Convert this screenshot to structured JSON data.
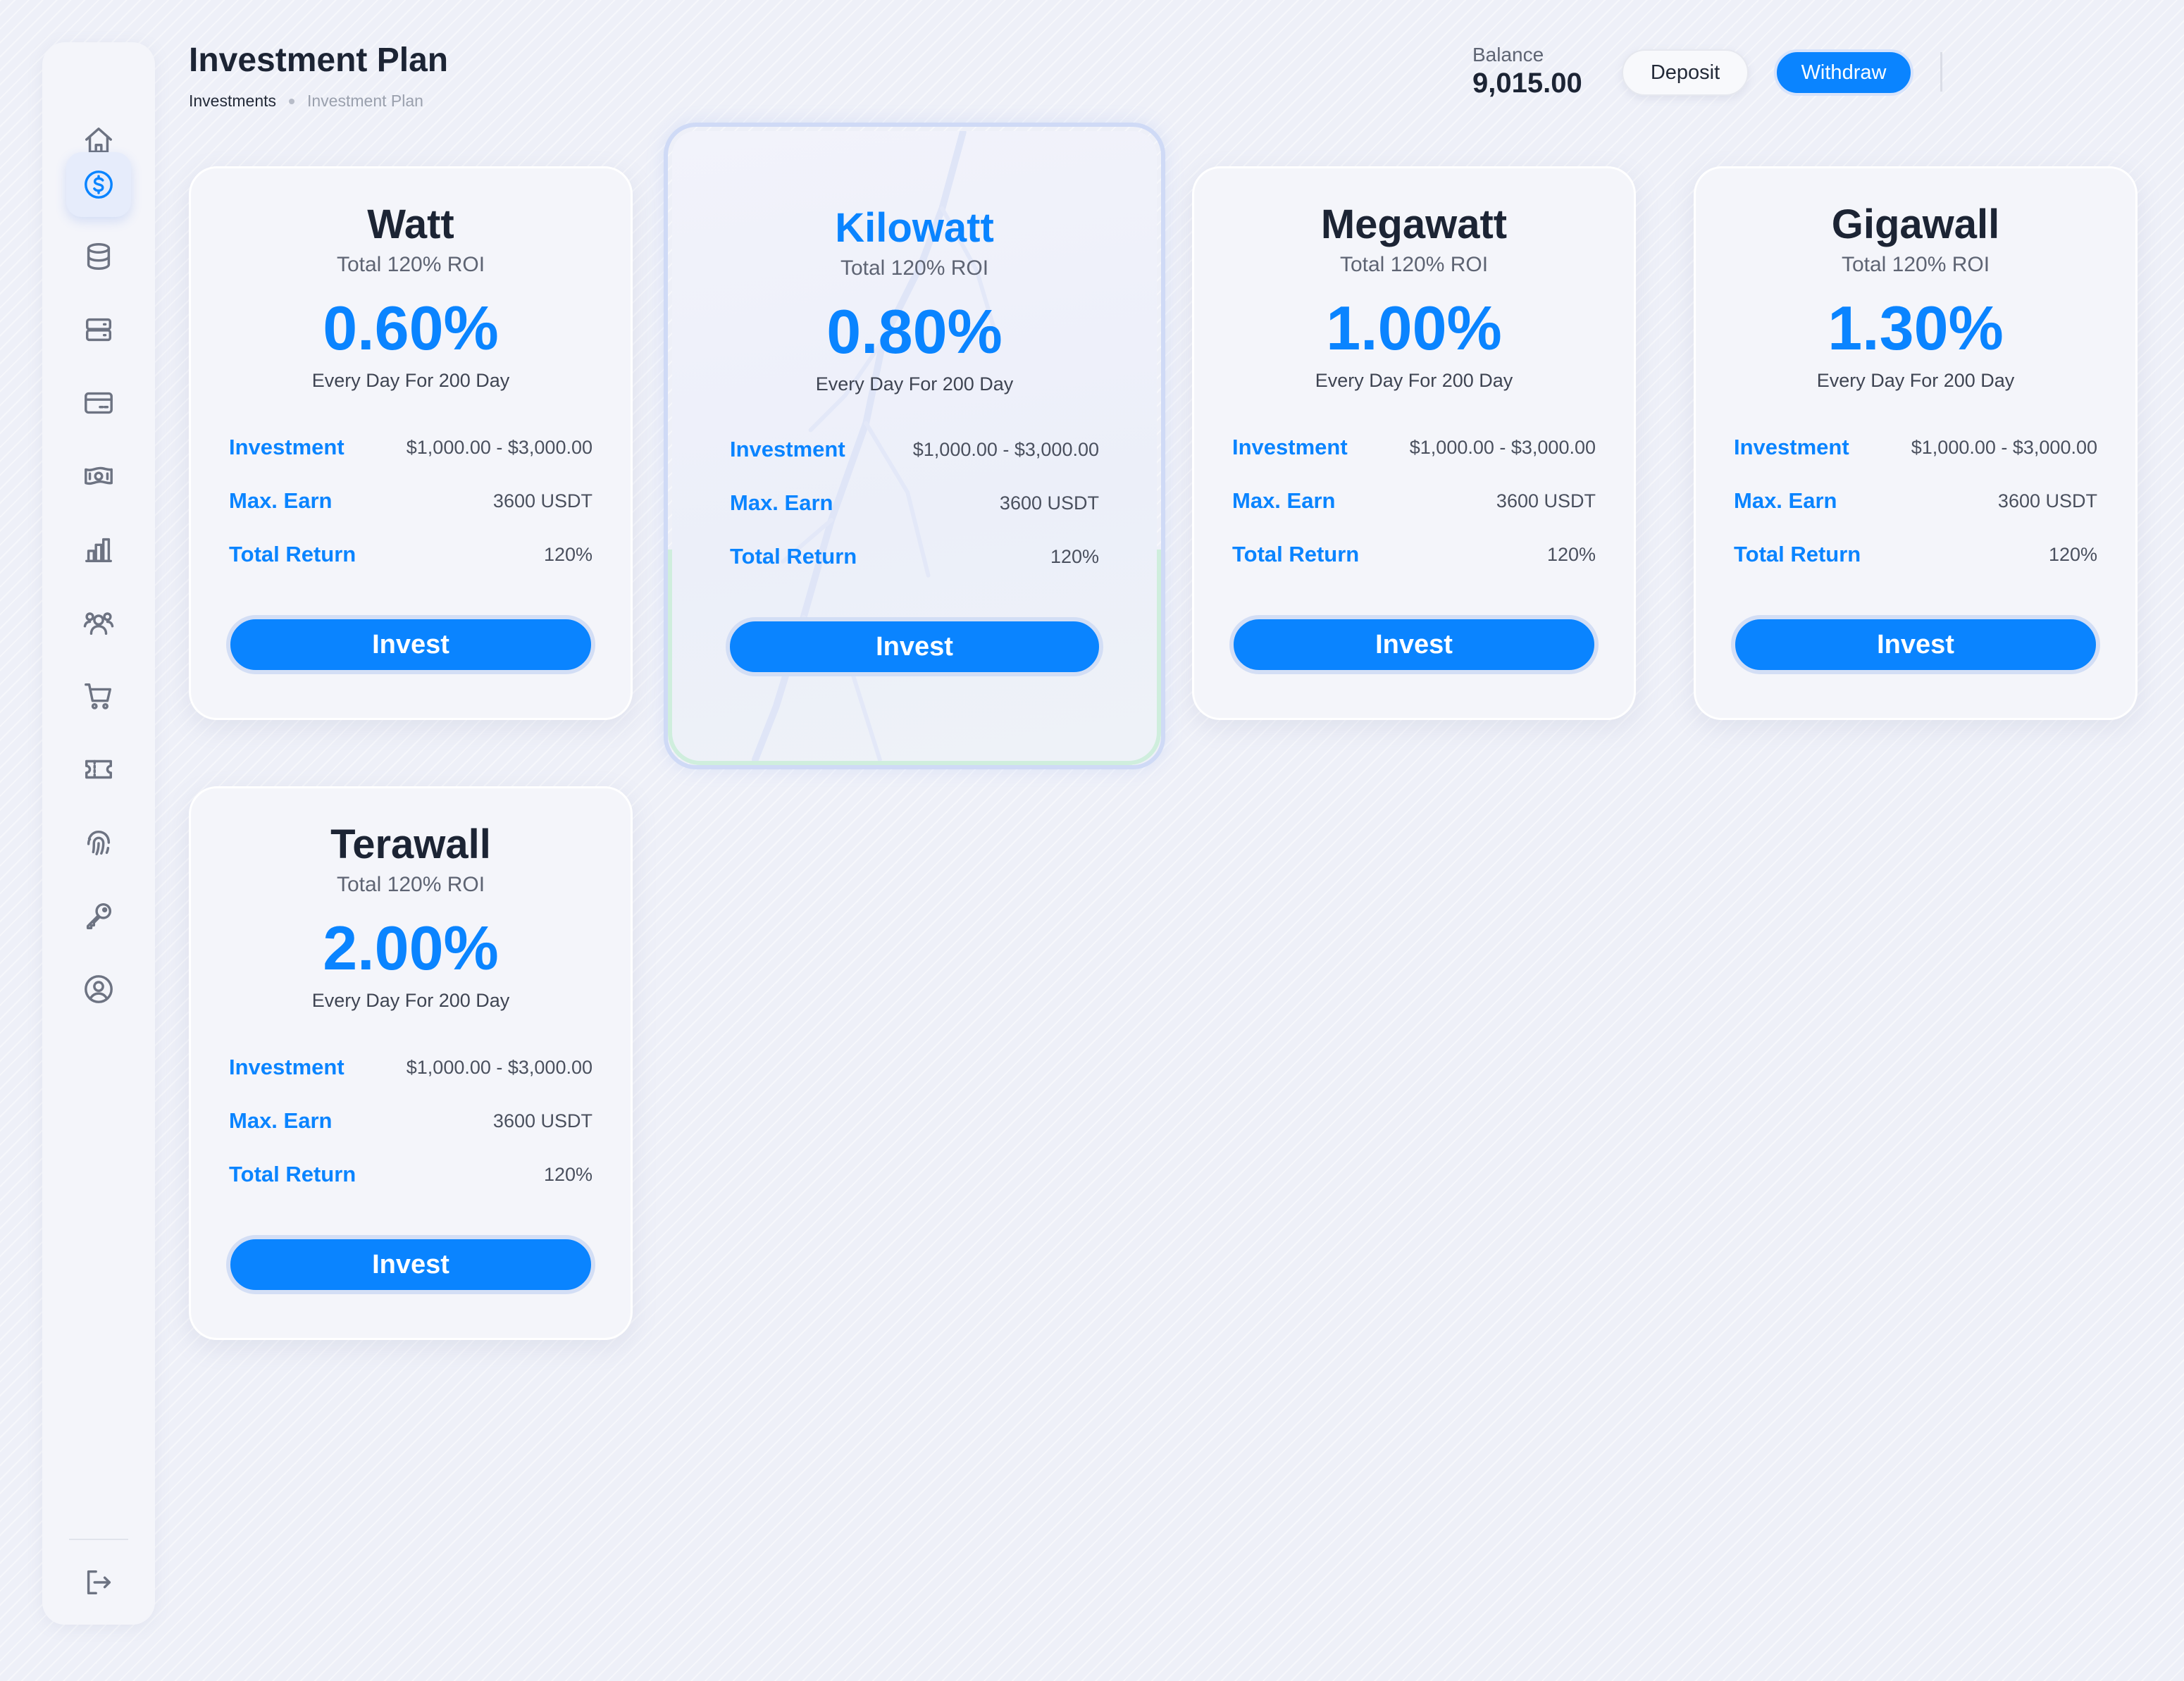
{
  "header": {
    "title": "Investment Plan",
    "breadcrumb": [
      "Investments",
      "Investment Plan"
    ],
    "balance_label": "Balance",
    "balance_value": "9,015.00",
    "deposit_label": "Deposit",
    "withdraw_label": "Withdraw"
  },
  "sidebar": {
    "items": [
      {
        "icon": "home-icon",
        "active": false
      },
      {
        "icon": "dollar-circle-icon",
        "active": true
      },
      {
        "icon": "database-icon",
        "active": false
      },
      {
        "icon": "server-icon",
        "active": false
      },
      {
        "icon": "credit-card-icon",
        "active": false
      },
      {
        "icon": "banknote-icon",
        "active": false
      },
      {
        "icon": "bar-chart-icon",
        "active": false
      },
      {
        "icon": "users-icon",
        "active": false
      },
      {
        "icon": "shopping-cart-icon",
        "active": false
      },
      {
        "icon": "ticket-icon",
        "active": false
      },
      {
        "icon": "fingerprint-icon",
        "active": false
      },
      {
        "icon": "key-icon",
        "active": false
      },
      {
        "icon": "user-circle-icon",
        "active": false
      }
    ],
    "logout_icon": "logout-icon"
  },
  "plans": [
    {
      "name": "Watt",
      "subtitle": "Total 120% ROI",
      "rate": "0.60%",
      "period": "Every Day For 200 Day",
      "investment_label": "Investment",
      "investment_value": "$1,000.00 - $3,000.00",
      "max_earn_label": "Max. Earn",
      "max_earn_value": "3600 USDT",
      "total_return_label": "Total Return",
      "total_return_value": "120%",
      "button_label": "Invest",
      "featured": false
    },
    {
      "name": "Kilowatt",
      "subtitle": "Total 120% ROI",
      "rate": "0.80%",
      "period": "Every Day For 200 Day",
      "investment_label": "Investment",
      "investment_value": "$1,000.00 - $3,000.00",
      "max_earn_label": "Max. Earn",
      "max_earn_value": "3600 USDT",
      "total_return_label": "Total Return",
      "total_return_value": "120%",
      "button_label": "Invest",
      "featured": true
    },
    {
      "name": "Megawatt",
      "subtitle": "Total 120% ROI",
      "rate": "1.00%",
      "period": "Every Day For 200 Day",
      "investment_label": "Investment",
      "investment_value": "$1,000.00 - $3,000.00",
      "max_earn_label": "Max. Earn",
      "max_earn_value": "3600 USDT",
      "total_return_label": "Total Return",
      "total_return_value": "120%",
      "button_label": "Invest",
      "featured": false
    },
    {
      "name": "Gigawall",
      "subtitle": "Total 120% ROI",
      "rate": "1.30%",
      "period": "Every Day For 200 Day",
      "investment_label": "Investment",
      "investment_value": "$1,000.00 - $3,000.00",
      "max_earn_label": "Max. Earn",
      "max_earn_value": "3600 USDT",
      "total_return_label": "Total Return",
      "total_return_value": "120%",
      "button_label": "Invest",
      "featured": false
    },
    {
      "name": "Terawall",
      "subtitle": "Total 120% ROI",
      "rate": "2.00%",
      "period": "Every Day For 200 Day",
      "investment_label": "Investment",
      "investment_value": "$1,000.00 - $3,000.00",
      "max_earn_label": "Max. Earn",
      "max_earn_value": "3600 USDT",
      "total_return_label": "Total Return",
      "total_return_value": "120%",
      "button_label": "Invest",
      "featured": false
    }
  ],
  "colors": {
    "accent": "#0a84ff",
    "text_dark": "#1c2434",
    "background": "#eef0f8"
  }
}
